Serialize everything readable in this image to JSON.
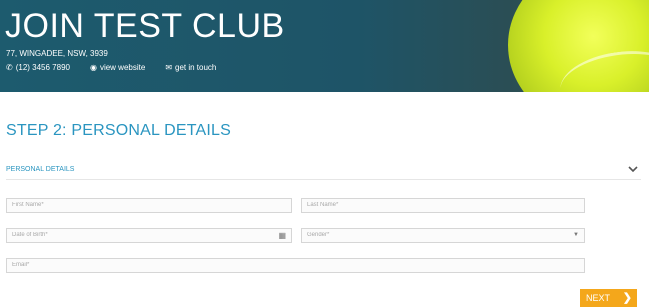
{
  "banner": {
    "title": "JOIN TEST CLUB",
    "address": "77, WINGADEE, NSW, 3939",
    "phone": "(12) 3456 7890",
    "website_label": "view website",
    "contact_label": "get in touch",
    "accent": "#1d5b6e"
  },
  "step": {
    "title": "STEP 2: PERSONAL DETAILS"
  },
  "section": {
    "label": "PERSONAL DETAILS",
    "expanded_icon": "chevron-down-icon"
  },
  "form": {
    "first_name": {
      "placeholder": "First Name*",
      "value": ""
    },
    "last_name": {
      "placeholder": "Last Name*",
      "value": ""
    },
    "dob": {
      "placeholder": "Date of Birth*",
      "value": ""
    },
    "gender": {
      "placeholder": "Gender*",
      "value": ""
    },
    "email": {
      "placeholder": "Email*",
      "value": ""
    }
  },
  "actions": {
    "next_label": "NEXT",
    "next_color": "#f4a71b"
  }
}
